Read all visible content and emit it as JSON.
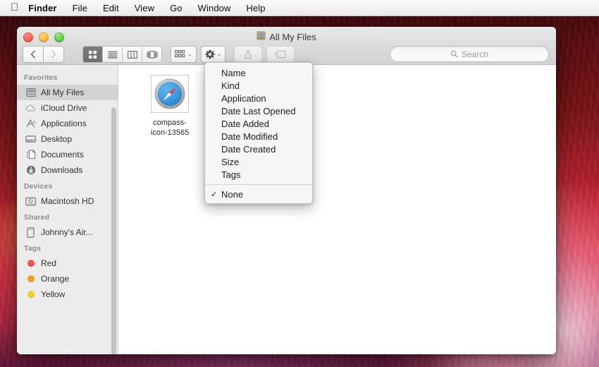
{
  "menubar": {
    "apple_icon": "apple-logo",
    "items": [
      {
        "label": "Finder",
        "bold": true
      },
      {
        "label": "File",
        "bold": false
      },
      {
        "label": "Edit",
        "bold": false
      },
      {
        "label": "View",
        "bold": false
      },
      {
        "label": "Go",
        "bold": false
      },
      {
        "label": "Window",
        "bold": false
      },
      {
        "label": "Help",
        "bold": false
      }
    ]
  },
  "window": {
    "title": "All My Files",
    "title_icon": "all-my-files-icon",
    "traffic_lights": {
      "close_color": "#e8534a",
      "minimize_color": "#f0ab2c",
      "zoom_color": "#49c13a"
    },
    "toolbar": {
      "back_icon": "chevron-left-icon",
      "forward_icon": "chevron-right-icon",
      "view_modes": [
        {
          "name": "icon-view",
          "icon": "grid-icon",
          "active": true
        },
        {
          "name": "list-view",
          "icon": "list-icon",
          "active": false
        },
        {
          "name": "column-view",
          "icon": "columns-icon",
          "active": false
        },
        {
          "name": "coverflow-view",
          "icon": "coverflow-icon",
          "active": false
        }
      ],
      "arrange_button": {
        "icon": "arrange-grid-icon",
        "chevron": "⌄"
      },
      "action_button": {
        "icon": "gear-icon",
        "chevron": "⌄"
      },
      "share_button": {
        "icon": "share-icon"
      },
      "tag_button": {
        "icon": "tag-icon"
      }
    },
    "search": {
      "icon": "search-icon",
      "placeholder": "Search",
      "value": ""
    }
  },
  "sidebar": {
    "sections": [
      {
        "header": "Favorites",
        "items": [
          {
            "label": "All My Files",
            "icon": "all-my-files-icon",
            "selected": true
          },
          {
            "label": "iCloud Drive",
            "icon": "cloud-icon",
            "selected": false
          },
          {
            "label": "Applications",
            "icon": "applications-icon",
            "selected": false
          },
          {
            "label": "Desktop",
            "icon": "desktop-icon",
            "selected": false
          },
          {
            "label": "Documents",
            "icon": "documents-icon",
            "selected": false
          },
          {
            "label": "Downloads",
            "icon": "downloads-icon",
            "selected": false
          }
        ]
      },
      {
        "header": "Devices",
        "items": [
          {
            "label": "Macintosh HD",
            "icon": "hard-drive-icon",
            "selected": false
          }
        ]
      },
      {
        "header": "Shared",
        "items": [
          {
            "label": "Johnny's Air...",
            "icon": "shared-device-icon",
            "selected": false
          }
        ]
      },
      {
        "header": "Tags",
        "items": [
          {
            "label": "Red",
            "icon": "tag-dot-icon",
            "color": "#f1564f",
            "selected": false
          },
          {
            "label": "Orange",
            "icon": "tag-dot-icon",
            "color": "#f0a028",
            "selected": false
          },
          {
            "label": "Yellow",
            "icon": "tag-dot-icon",
            "color": "#f2cf2c",
            "selected": false
          }
        ]
      }
    ]
  },
  "content": {
    "files": [
      {
        "name_line1": "compass-",
        "name_line2": "icon-13565",
        "icon": "compass-icon"
      }
    ]
  },
  "arrange_menu": {
    "items": [
      {
        "label": "Name",
        "checked": false
      },
      {
        "label": "Kind",
        "checked": false
      },
      {
        "label": "Application",
        "checked": false
      },
      {
        "label": "Date Last Opened",
        "checked": false
      },
      {
        "label": "Date Added",
        "checked": false
      },
      {
        "label": "Date Modified",
        "checked": false
      },
      {
        "label": "Date Created",
        "checked": false
      },
      {
        "label": "Size",
        "checked": false
      },
      {
        "label": "Tags",
        "checked": false
      },
      {
        "separator": true
      },
      {
        "label": "None",
        "checked": true
      }
    ],
    "check_glyph": "✓"
  }
}
